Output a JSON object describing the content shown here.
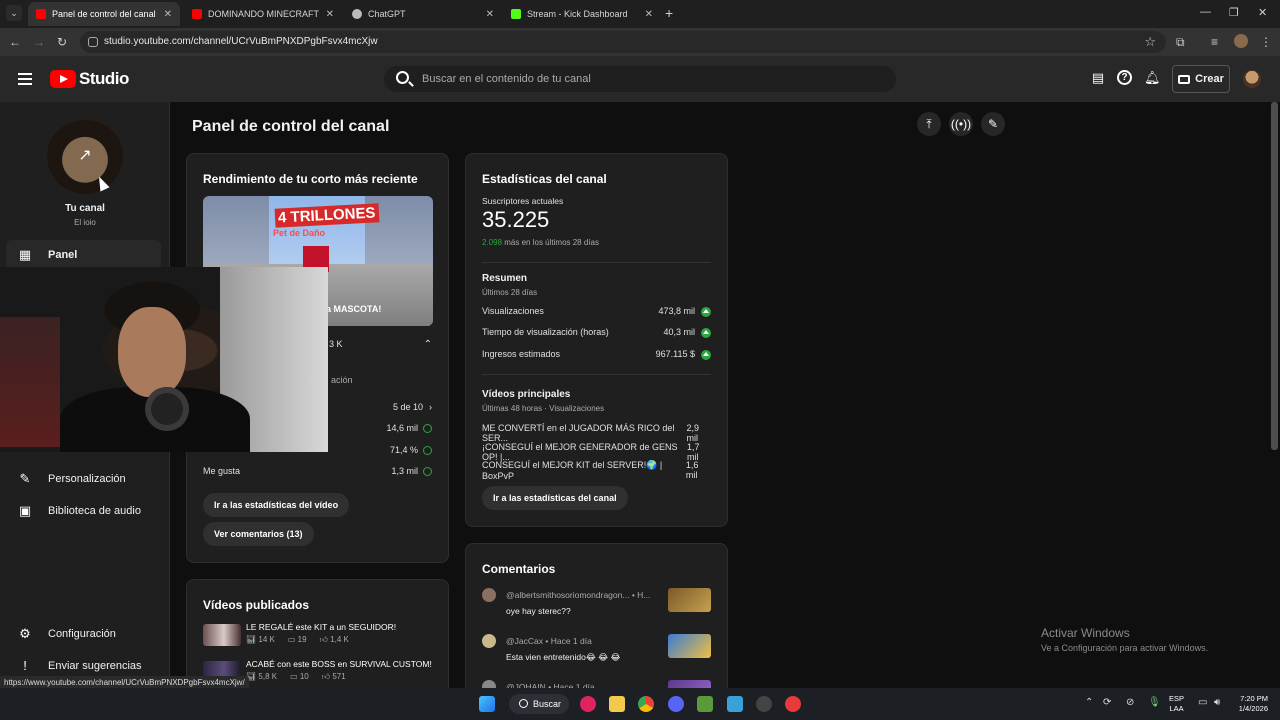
{
  "browser": {
    "tabs": [
      {
        "title": "Panel de control del canal - You",
        "favicon_color": "#ff0000"
      },
      {
        "title": "DOMINANDO MINECRAFT HAR",
        "favicon_color": "#ff0000"
      },
      {
        "title": "ChatGPT",
        "favicon_color": "#bbbbbb"
      },
      {
        "title": "Stream - Kick Dashboard",
        "favicon_color": "#53fc18"
      }
    ],
    "url": "studio.youtube.com/channel/UCrVuBmPNXDPgbFsvx4mcXjw",
    "status_url": "https://www.youtube.com/channel/UCrVuBmPNXDPgbFsvx4mcXjw/"
  },
  "header": {
    "logo_text": "Studio",
    "search_placeholder": "Buscar en el contenido de tu canal",
    "create_label": "Crear"
  },
  "sidebar": {
    "channel_name": "Tu canal",
    "channel_handle": "El ioio",
    "items": [
      {
        "label": "Panel",
        "icon": "dashboard-icon"
      },
      {
        "label": "Personalización",
        "icon": "magic-wand-icon"
      },
      {
        "label": "Biblioteca de audio",
        "icon": "audio-library-icon"
      }
    ],
    "bottom": [
      {
        "label": "Configuración",
        "icon": "gear-icon"
      },
      {
        "label": "Enviar sugerencias",
        "icon": "feedback-icon"
      }
    ]
  },
  "main": {
    "title": "Panel de control del canal",
    "latest_short": {
      "heading": "Rendimiento de tu corto más reciente",
      "thumb_text": "4 TRILLONES",
      "thumb_subtext": "Pet de Daño",
      "thumb_caption": "esta MASCOTA!",
      "views_partial": "3 K",
      "ranking_partial": "ación",
      "stats": [
        {
          "label": "",
          "value": "5 de 10"
        },
        {
          "label": "",
          "value": "14,6 mil"
        },
        {
          "label": "",
          "value": "71,4 %"
        },
        {
          "label": "Me gusta",
          "value": "1,3 mil"
        }
      ],
      "btn_stats": "Ir a las estadísticas del vídeo",
      "btn_comments": "Ver comentarios (13)"
    },
    "published": {
      "heading": "Vídeos publicados",
      "videos": [
        {
          "title": "LE REGALÉ este KIT a un SEGUIDOR!",
          "views": "14 K",
          "comments": "19",
          "likes": "1,4 K"
        },
        {
          "title": "ACABÉ con este BOSS en SURVIVAL CUSTOM!",
          "views": "5,8 K",
          "comments": "10",
          "likes": "571"
        }
      ]
    },
    "channel_stats": {
      "heading": "Estadísticas del canal",
      "subs_label": "Suscriptores actuales",
      "subs_value": "35.225",
      "subs_delta": "2.098",
      "subs_delta_text": "más en los últimos 28 días",
      "summary_heading": "Resumen",
      "summary_period": "Últimos 28 días",
      "summary": [
        {
          "label": "Visualizaciones",
          "value": "473,8 mil"
        },
        {
          "label": "Tiempo de visualización (horas)",
          "value": "40,3 mil"
        },
        {
          "label": "Ingresos estimados",
          "value": "967.115 $"
        }
      ],
      "top_heading": "Vídeos principales",
      "top_period": "Últimas 48 horas · Visualizaciones",
      "top_videos": [
        {
          "title": "ME CONVERTÍ en el JUGADOR MÁS RICO del SER...",
          "value": "2,9 mil"
        },
        {
          "title": "¡CONSEGUÍ el MEJOR GENERADOR de GENS OP! |...",
          "value": "1,7 mil"
        },
        {
          "title": "CONSEGUÍ el MEJOR KIT del SERVER!🌍 | BoxPvP",
          "value": "1,6 mil"
        }
      ],
      "btn": "Ir a las estadísticas del canal"
    },
    "comments": {
      "heading": "Comentarios",
      "items": [
        {
          "author": "@albertsmithosoriomondragon...",
          "time": "• H...",
          "text": "oye hay sterec??"
        },
        {
          "author": "@JacCax",
          "time": "• Hace 1 día",
          "text": "Esta vien entretenido😂 😂 😂"
        },
        {
          "author": "@JOHAIN",
          "time": "• Hace 1 día",
          "text": ""
        }
      ]
    }
  },
  "watermark": {
    "line1": "Activar Windows",
    "line2": "Ve a Configuración para activar Windows."
  },
  "taskbar": {
    "search_label": "Buscar",
    "lang_top": "ESP",
    "lang_bottom": "LAA",
    "time": "7:20 PM",
    "date": "1/4/2026"
  },
  "colors": {
    "brand_red": "#ff0000",
    "success_green": "#2ba640",
    "background": "#0f0f0f",
    "card": "#1f1f1f"
  }
}
